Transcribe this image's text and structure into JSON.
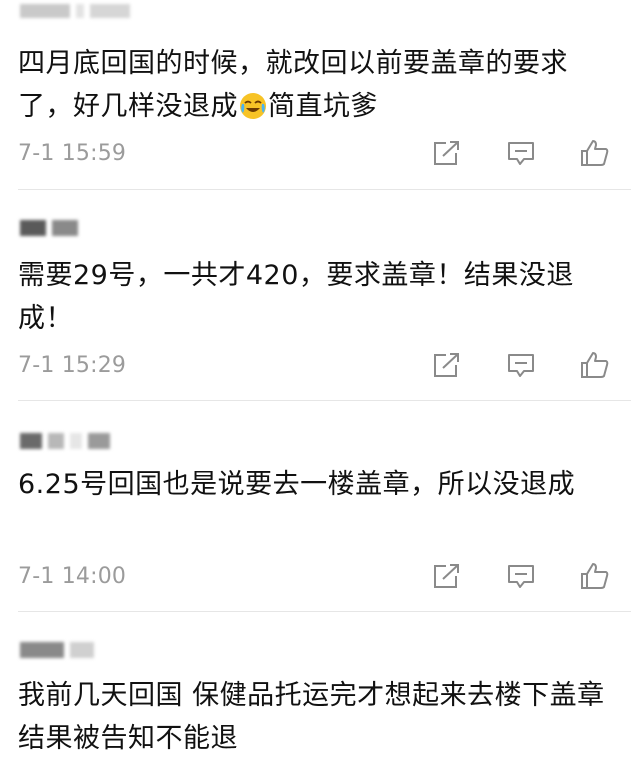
{
  "comments": [
    {
      "text_before": "四月底回国的时候，就改回以前要盖章的要求了，好几样没退成",
      "emoji": "crying-laughing-emoji",
      "text_after": "简直坑爹",
      "timestamp": "7-1 15:59"
    },
    {
      "text": "需要29号，一共才420，要求盖章！结果没退成！",
      "timestamp": "7-1 15:29"
    },
    {
      "text": "6.25号回国也是说要去一楼盖章，所以没退成",
      "timestamp": "7-1 14:00"
    },
    {
      "text": "我前几天回国 保健品托运完才想起来去楼下盖章 结果被告知不能退"
    }
  ],
  "icons": {
    "share": "share-icon",
    "reply": "reply-icon",
    "like": "like-icon"
  },
  "colors": {
    "text": "#111111",
    "meta": "#9b9b9b",
    "icon": "#8a8a8a",
    "divider": "#e6e6e6",
    "emoji_face": "#f7c326"
  }
}
